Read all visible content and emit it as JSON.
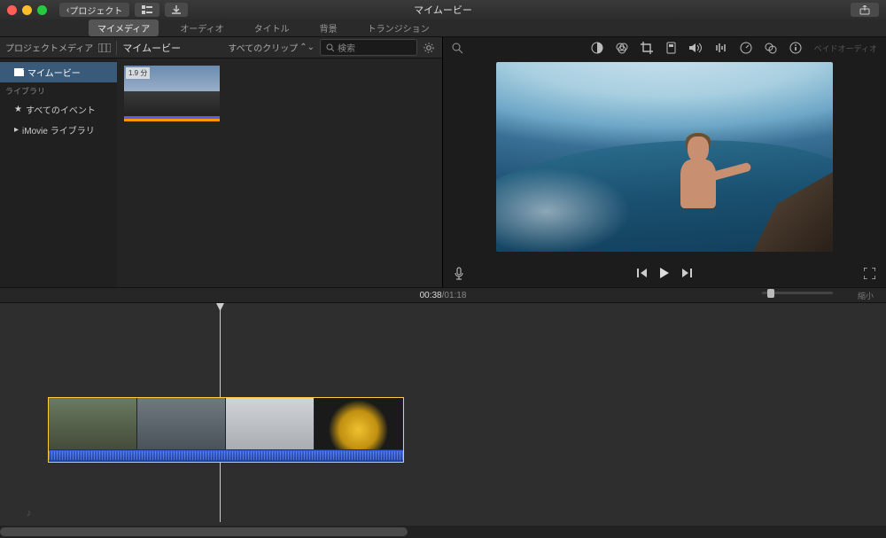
{
  "titlebar": {
    "back_label": "プロジェクト",
    "title": "マイムービー"
  },
  "tabs": {
    "items": [
      {
        "label": "マイメディア"
      },
      {
        "label": "オーディオ"
      },
      {
        "label": "タイトル"
      },
      {
        "label": "背景"
      },
      {
        "label": "トランジション"
      }
    ]
  },
  "left_header": {
    "section": "プロジェクトメディア",
    "project": "マイムービー",
    "clips_dropdown": "すべてのクリップ",
    "search_placeholder": "検索"
  },
  "sidebar": {
    "media_selected": "マイムービー",
    "library_header": "ライブラリ",
    "all_events": "すべてのイベント",
    "imovie_library": "iMovie ライブラリ"
  },
  "thumb": {
    "duration_badge": "1.9 分"
  },
  "viewer_toolbar": {
    "disabled_text": "ベイドオーディオ"
  },
  "playback": {
    "current": "00:38",
    "sep": " / ",
    "total": "01:18"
  },
  "zoom": {
    "label": "縮小"
  }
}
